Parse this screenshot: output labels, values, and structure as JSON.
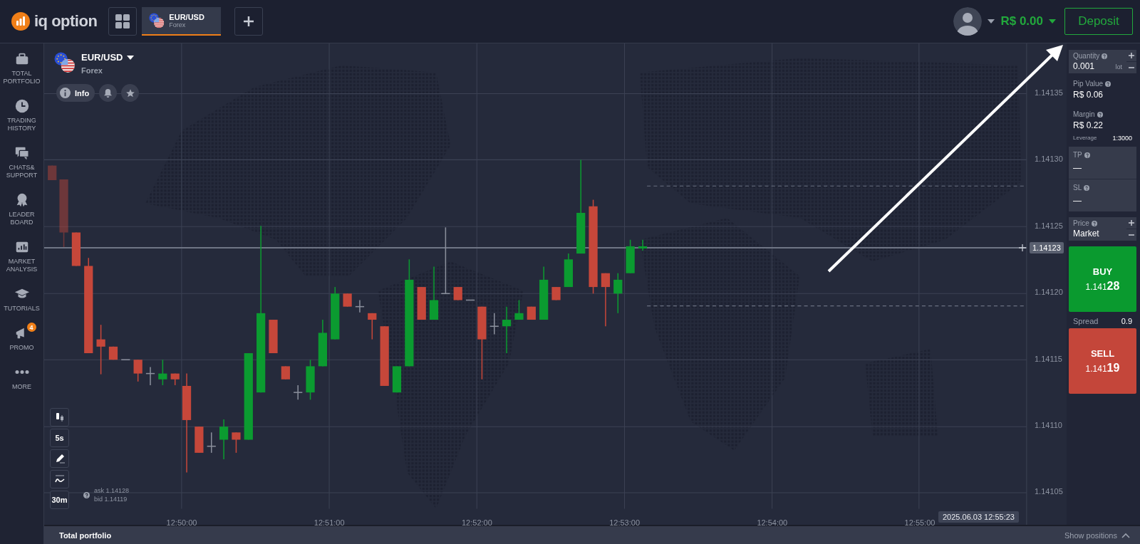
{
  "header": {
    "logo_text": "iq option",
    "tabs": [
      {
        "pair": "EUR/USD",
        "market": "Forex",
        "selected": true
      }
    ],
    "balance": "R$ 0.00",
    "deposit_button": "Deposit"
  },
  "sidebar": {
    "items": [
      {
        "label": "TOTAL PORTFOLIO"
      },
      {
        "label": "TRADING HISTORY"
      },
      {
        "label": "CHATS& SUPPORT"
      },
      {
        "label": "LEADER BOARD"
      },
      {
        "label": "MARKET ANALYSIS"
      },
      {
        "label": "TUTORIALS"
      },
      {
        "label": "PROMO",
        "badge": "4"
      },
      {
        "label": "MORE"
      }
    ]
  },
  "asset": {
    "pair": "EUR/USD",
    "market": "Forex",
    "info_button": "Info"
  },
  "chart": {
    "price_ticks": [
      "1.14135",
      "1.14130",
      "1.14125",
      "1.14120",
      "1.14115",
      "1.14110",
      "1.14105"
    ],
    "time_ticks": [
      "12:50:00",
      "12:51:00",
      "12:52:00",
      "12:53:00",
      "12:54:00",
      "12:55:00"
    ],
    "current_price": "1.14123",
    "cursor_time": "2025.06.03 12:55:23",
    "ask": "ask 1.14128",
    "bid": "bid 1.14119"
  },
  "chart_tools": {
    "interval": "5s",
    "timeframe": "30m"
  },
  "order_panel": {
    "quantity": {
      "label": "Quantity",
      "value": "0.001",
      "unit": "lot"
    },
    "pip_value": {
      "label": "Pip Value",
      "value": "R$ 0.06"
    },
    "margin": {
      "label": "Margin",
      "value": "R$ 0.22"
    },
    "leverage": {
      "label": "Leverage",
      "value": "1:3000"
    },
    "tp": {
      "label": "TP",
      "value": "—"
    },
    "sl": {
      "label": "SL",
      "value": "—"
    },
    "price": {
      "label": "Price",
      "value": "Market"
    },
    "buy": {
      "label": "BUY",
      "price": "1.141**28**"
    },
    "spread": {
      "label": "Spread",
      "value": "0.9"
    },
    "sell": {
      "label": "SELL",
      "price": "1.141**19**"
    }
  },
  "bottom_bar": {
    "title": "Total portfolio",
    "show_positions": "Show positions"
  }
}
